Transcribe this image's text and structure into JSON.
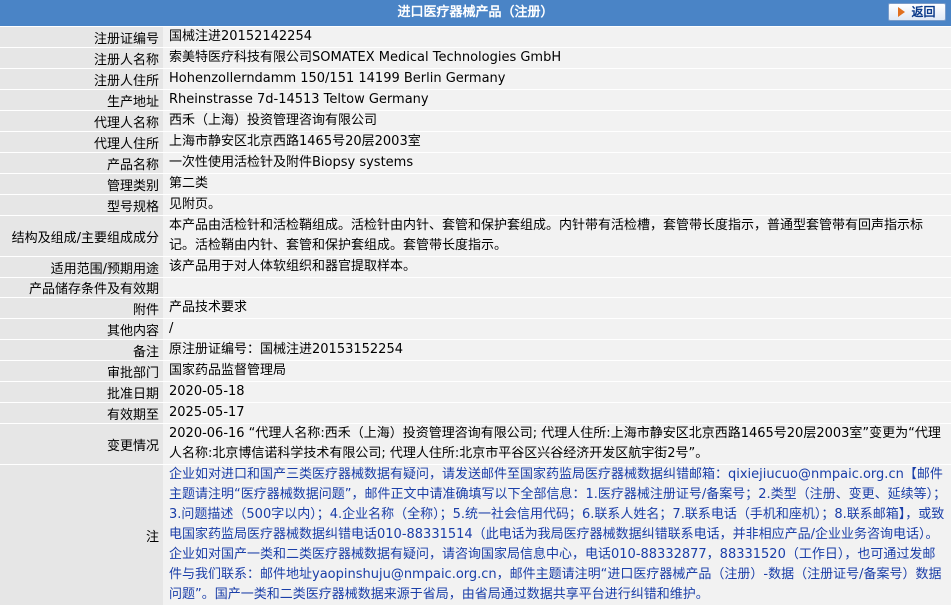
{
  "header": {
    "title": "进口医疗器械产品（注册）",
    "back_label": "返回"
  },
  "rows": [
    {
      "label": "注册证编号",
      "value": "国械注进20152142254"
    },
    {
      "label": "注册人名称",
      "value": "索美特医疗科技有限公司SOMATEX Medical Technologies GmbH"
    },
    {
      "label": "注册人住所",
      "value": "Hohenzollerndamm 150/151 14199 Berlin Germany"
    },
    {
      "label": "生产地址",
      "value": "Rheinstrasse 7d-14513 Teltow Germany"
    },
    {
      "label": "代理人名称",
      "value": "西禾（上海）投资管理咨询有限公司"
    },
    {
      "label": "代理人住所",
      "value": "上海市静安区北京西路1465号20层2003室"
    },
    {
      "label": "产品名称",
      "value": "一次性使用活检针及附件Biopsy systems"
    },
    {
      "label": "管理类别",
      "value": "第二类"
    },
    {
      "label": "型号规格",
      "value": "见附页。"
    },
    {
      "label": "结构及组成/主要组成成分",
      "value": "本产品由活检针和活检鞘组成。活检针由内针、套管和保护套组成。内针带有活检槽，套管带长度指示，普通型套管带有回声指示标记。活检鞘由内针、套管和保护套组成。套管带长度指示。"
    },
    {
      "label": "适用范围/预期用途",
      "value": "该产品用于对人体软组织和器官提取样本。"
    },
    {
      "label": "产品储存条件及有效期",
      "value": ""
    },
    {
      "label": "附件",
      "value": "产品技术要求"
    },
    {
      "label": "其他内容",
      "value": "/"
    },
    {
      "label": "备注",
      "value": "原注册证编号：国械注进20153152254"
    },
    {
      "label": "审批部门",
      "value": "国家药品监督管理局"
    },
    {
      "label": "批准日期",
      "value": "2020-05-18"
    },
    {
      "label": "有效期至",
      "value": "2025-05-17"
    },
    {
      "label": "变更情况",
      "value": "2020-06-16 “代理人名称:西禾（上海）投资管理咨询有限公司; 代理人住所:上海市静安区北京西路1465号20层2003室”变更为“代理人名称:北京博信诺科学技术有限公司; 代理人住所:北京市平谷区兴谷经济开发区航宇街2号”。"
    },
    {
      "label": "注",
      "value": "企业如对进口和国产三类医疗器械数据有疑问，请发送邮件至国家药监局医疗器械数据纠错邮箱：qixiejiucuo@nmpaic.org.cn【邮件主题请注明“医疗器械数据问题”，邮件正文中请准确填写以下全部信息：1.医疗器械注册证号/备案号；2.类型（注册、变更、延续等）；3.问题描述（500字以内）；4.企业名称（全称）；5.统一社会信用代码；6.联系人姓名；7.联系电话（手机和座机）；8.联系邮箱】，或致电国家药监局医疗器械数据纠错电话010-88331514（此电话为我局医疗器械数据纠错联系电话，并非相应产品/企业业务咨询电话）。企业如对国产一类和二类医疗器械数据有疑问，请咨询国家局信息中心，电话010-88332877，88331520（工作日），也可通过发邮件与我们联系：邮件地址yaopinshuju@nmpaic.org.cn，邮件主题请注明“进口医疗器械产品（注册）-数据（注册证号/备案号）数据问题”。国产一类和二类医疗器械数据来源于省局，由省局通过数据共享平台进行纠错和维护。"
    }
  ]
}
